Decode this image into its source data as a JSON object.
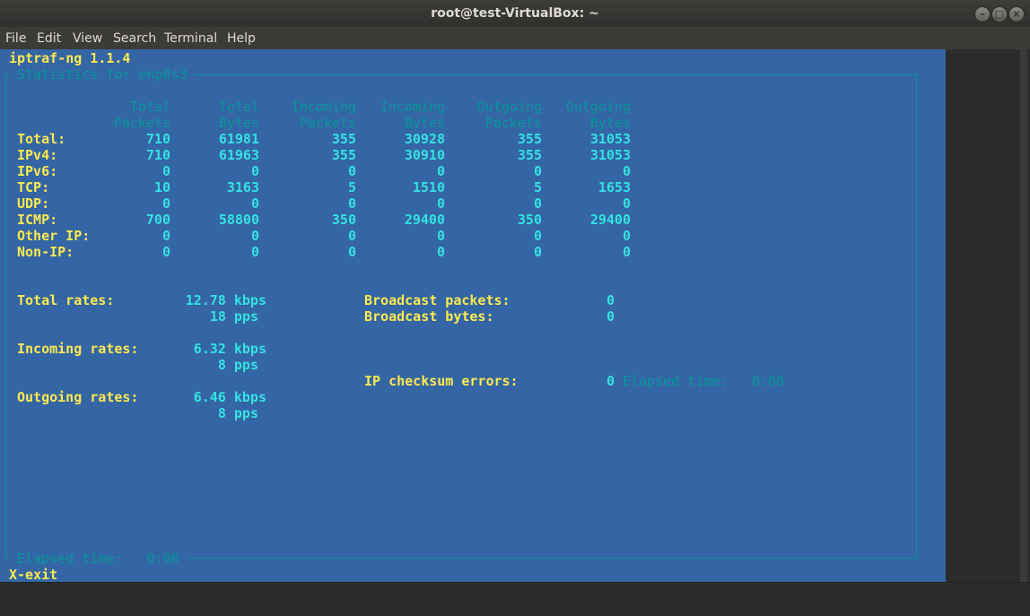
{
  "window": {
    "title": "root@test-VirtualBox: ~"
  },
  "menu": [
    "File",
    "Edit",
    "View",
    "Search",
    "Terminal",
    "Help"
  ],
  "app": {
    "name": "iptraf-ng 1.1.4",
    "panel_title": "Statistics for enp0s3",
    "headers": [
      [
        "Total",
        "Packets"
      ],
      [
        "Total",
        "Bytes"
      ],
      [
        "Incoming",
        "Packets"
      ],
      [
        "Incoming",
        "Bytes"
      ],
      [
        "Outgoing",
        "Packets"
      ],
      [
        "Outgoing",
        "Bytes"
      ]
    ],
    "rows": [
      {
        "label": "Total:",
        "values": [
          "710",
          "61981",
          "355",
          "30928",
          "355",
          "31053"
        ]
      },
      {
        "label": "IPv4:",
        "values": [
          "710",
          "61963",
          "355",
          "30910",
          "355",
          "31053"
        ]
      },
      {
        "label": "IPv6:",
        "values": [
          "0",
          "0",
          "0",
          "0",
          "0",
          "0"
        ]
      },
      {
        "label": "TCP:",
        "values": [
          "10",
          "3163",
          "5",
          "1510",
          "5",
          "1653"
        ]
      },
      {
        "label": "UDP:",
        "values": [
          "0",
          "0",
          "0",
          "0",
          "0",
          "0"
        ]
      },
      {
        "label": "ICMP:",
        "values": [
          "700",
          "58800",
          "350",
          "29400",
          "350",
          "29400"
        ]
      },
      {
        "label": "Other IP:",
        "values": [
          "0",
          "0",
          "0",
          "0",
          "0",
          "0"
        ]
      },
      {
        "label": "Non-IP:",
        "values": [
          "0",
          "0",
          "0",
          "0",
          "0",
          "0"
        ]
      }
    ],
    "rates": {
      "total_label": "Total rates:",
      "total_kbps": "12.78 kbps",
      "total_pps": "18 pps",
      "incoming_label": "Incoming rates:",
      "incoming_kbps": "6.32 kbps",
      "incoming_pps": "8 pps",
      "outgoing_label": "Outgoing rates:",
      "outgoing_kbps": "6.46 kbps",
      "outgoing_pps": "8 pps"
    },
    "broadcast": {
      "packets_label": "Broadcast packets:",
      "packets_value": "0",
      "bytes_label": "Broadcast bytes:",
      "bytes_value": "0"
    },
    "checksum": {
      "label": "IP checksum errors:",
      "value": "0"
    },
    "elapsed_inline": {
      "label": "Elapsed time:",
      "value": "0:00"
    },
    "elapsed_bottom": {
      "label": "Elapsed time:",
      "value": "0:00"
    },
    "exit_hint": "X-exit"
  },
  "colors": {
    "terminal_bg": "#3465a4",
    "label": "#fce94f",
    "value": "#34e2e2",
    "dim": "#06989a"
  }
}
